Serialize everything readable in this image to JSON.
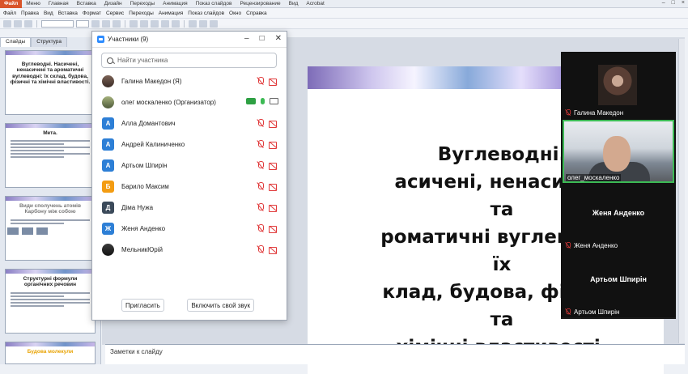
{
  "menubar": {
    "file": "Файл",
    "items": [
      "Меню",
      "Главная",
      "Вставка",
      "Дизайн",
      "Переходы",
      "Анимация",
      "Показ слайдов",
      "Рецензирование",
      "Вид",
      "Acrobat"
    ],
    "items2": [
      "Файл",
      "Правка",
      "Вид",
      "Вставка",
      "Формат",
      "Сервис",
      "Переходы",
      "Анимация",
      "Показ слайдов",
      "Окно",
      "Справка"
    ]
  },
  "left_pane": {
    "tabs": [
      "Слайды",
      "Структура"
    ],
    "thumbs": [
      {
        "num": "1",
        "title": "Вуглеводні. Насичені, ненасичені та ароматичні вуглеводні: їх склад, будова, фізичні та хімічні властивості."
      },
      {
        "num": "2",
        "title": "Мета."
      },
      {
        "num": "3",
        "title": "Види сполучень атомів Карбону між собою"
      },
      {
        "num": "4",
        "title": "Структурні формули органічних речовин"
      },
      {
        "num": "5",
        "title": "Будова молекули"
      }
    ]
  },
  "slide": {
    "title": "Вуглеводні.\nасичені, ненасичені та\nроматичні вуглеводні: їх\nклад, будова, фізичні та\nхімічні властивості."
  },
  "notes": {
    "placeholder": "Заметки к слайду"
  },
  "participants": {
    "title": "Участники (9)",
    "search_placeholder": "Найти участника",
    "list": [
      {
        "initial": "",
        "name": "Галина Македон (Я)",
        "color": "#6b4b3e",
        "photo": true,
        "muted": true
      },
      {
        "initial": "",
        "name": "олег москаленко (Организатор)",
        "color": "#6b4b3e",
        "photo": true,
        "muted": false
      },
      {
        "initial": "А",
        "name": "Алла Домантович",
        "color": "#2d7fd6",
        "muted": true
      },
      {
        "initial": "А",
        "name": "Андрей Калиниченко",
        "color": "#2d7fd6",
        "muted": true
      },
      {
        "initial": "А",
        "name": "Артьом Шпирін",
        "color": "#2d7fd6",
        "muted": true
      },
      {
        "initial": "Б",
        "name": "Барило Максим",
        "color": "#f39c12",
        "muted": true
      },
      {
        "initial": "Д",
        "name": "Діма Нужа",
        "color": "#3b4a5a",
        "muted": true
      },
      {
        "initial": "Ж",
        "name": "Женя Анденко",
        "color": "#2d7fd6",
        "muted": true
      },
      {
        "initial": "",
        "name": "МельникЮрій",
        "color": "#6b4b3e",
        "photo": true,
        "muted": true
      }
    ],
    "invite": "Пригласить",
    "unmute": "Включить свой звук"
  },
  "videos": [
    {
      "name": "Галина Македон",
      "type": "photo"
    },
    {
      "name": "олег_москаленко",
      "type": "video"
    },
    {
      "name": "Женя Анденко",
      "type": "name"
    },
    {
      "name": "Артьом Шпирін",
      "type": "name"
    }
  ]
}
